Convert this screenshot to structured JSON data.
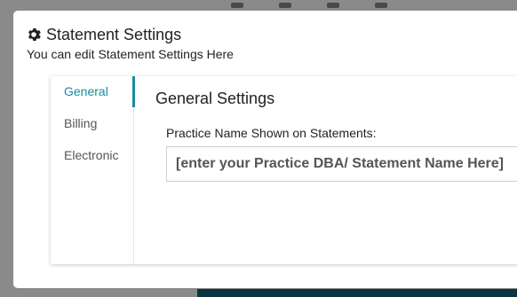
{
  "modal": {
    "title": "Statement Settings",
    "subtitle": "You can edit Statement Settings Here"
  },
  "tabs": [
    {
      "label": "General",
      "active": true
    },
    {
      "label": "Billing",
      "active": false
    },
    {
      "label": "Electronic",
      "active": false
    }
  ],
  "general": {
    "section_title": "General Settings",
    "practice_name_label": "Practice Name Shown on Statements:",
    "practice_name_value": "[enter your Practice DBA/ Statement Name Here]"
  },
  "colors": {
    "accent": "#1a8ba1",
    "overlay": "#8a8a8a"
  }
}
